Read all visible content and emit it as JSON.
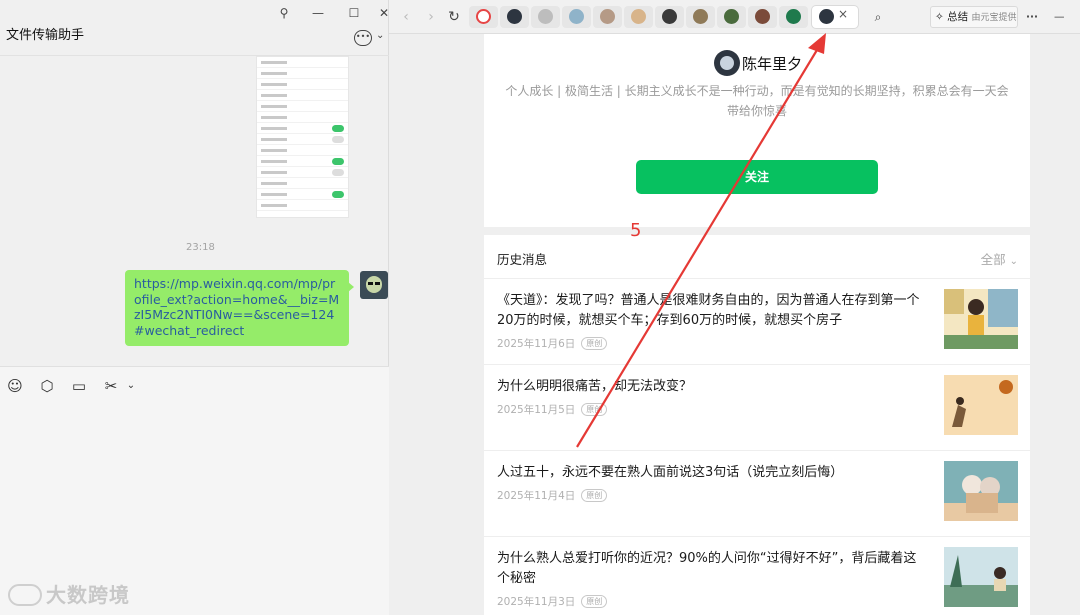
{
  "wechat": {
    "title": "文件传输助手",
    "timestamp": "23:18",
    "message": "https://mp.weixin.qq.com/mp/profile_ext?action=home&__biz=MzI5Mzc2NTI0Nw==&scene=124#wechat_redirect",
    "icons": [
      "pin-icon",
      "minimize-icon",
      "maximize-icon",
      "close-icon",
      "chat-icon",
      "emoji-icon",
      "box-icon",
      "folder-icon",
      "scissors-icon"
    ]
  },
  "browser": {
    "summary_label": "总结",
    "summary_sub": "由元宝提供",
    "tab_close": "×",
    "more": "···",
    "minimize": "—"
  },
  "profile": {
    "name": "陈年里夕",
    "description": "个人成长 | 极简生活 | 长期主义成长不是一种行动，而是有觉知的长期坚持，积累总会有一天会带给你惊喜",
    "follow_label": "关注"
  },
  "history": {
    "title": "历史消息",
    "filter": "全部",
    "articles": [
      {
        "title": "《天道》：发现了吗？普通人是很难财务自由的，因为普通人在存到第一个20万的时候，就想买个车；存到60万的时候，就想买个房子",
        "date": "2025年11月6日",
        "badge": "原创"
      },
      {
        "title": "为什么明明很痛苦，却无法改变？",
        "date": "2025年11月5日",
        "badge": "原创"
      },
      {
        "title": "人过五十，永远不要在熟人面前说这3句话（说完立刻后悔）",
        "date": "2025年11月4日",
        "badge": "原创"
      },
      {
        "title": "为什么熟人总爱打听你的近况？90%的人问你“过得好不好”，背后藏着这个秘密",
        "date": "2025年11月3日",
        "badge": "原创"
      }
    ]
  },
  "annotation": {
    "number": "5",
    "color": "#e53935"
  },
  "watermark": "大数跨境",
  "colors": {
    "wechat_green": "#07c160",
    "bubble_green": "#95ec69"
  }
}
